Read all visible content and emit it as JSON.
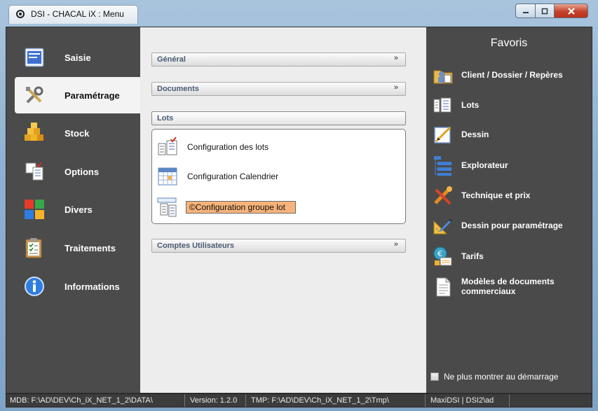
{
  "window": {
    "title": "DSI - CHACAL iX : Menu"
  },
  "nav": {
    "items": [
      {
        "label": "Saisie",
        "icon": "form-icon"
      },
      {
        "label": "Paramétrage",
        "icon": "tools-icon",
        "active": true
      },
      {
        "label": "Stock",
        "icon": "stock-boxes-icon"
      },
      {
        "label": "Options",
        "icon": "options-checklist-icon"
      },
      {
        "label": "Divers",
        "icon": "colored-squares-icon"
      },
      {
        "label": "Traitements",
        "icon": "clipboard-icon"
      },
      {
        "label": "Informations",
        "icon": "info-icon"
      }
    ]
  },
  "middle": {
    "sections": [
      {
        "label": "Général",
        "chevron": "»"
      },
      {
        "label": "Documents",
        "chevron": "»"
      },
      {
        "label": "Lots"
      },
      {
        "label": "Comptes Utilisateurs",
        "chevron": "»"
      }
    ],
    "lots_items": [
      {
        "label": "Configuration des lots",
        "icon": "lots-config-icon"
      },
      {
        "label": "Configuration Calendrier",
        "icon": "calendar-icon"
      },
      {
        "label": "©Configuration groupe lot",
        "icon": "group-lot-icon",
        "selected": true
      }
    ]
  },
  "favoris": {
    "title": "Favoris",
    "items": [
      {
        "label": "Client / Dossier / Repères",
        "icon": "client-folder-icon"
      },
      {
        "label": "Lots",
        "icon": "lots-icon"
      },
      {
        "label": "Dessin",
        "icon": "drawing-icon"
      },
      {
        "label": "Explorateur",
        "icon": "explorer-icon"
      },
      {
        "label": "Technique et prix",
        "icon": "tools-price-icon"
      },
      {
        "label": "Dessin pour paramétrage",
        "icon": "ruler-icon"
      },
      {
        "label": "Tarifs",
        "icon": "tariffs-icon"
      },
      {
        "label": "Modèles de documents commerciaux",
        "icon": "document-icon"
      }
    ],
    "startup_checkbox": {
      "label": "Ne plus montrer au démarrage",
      "checked": false
    }
  },
  "statusbar": {
    "mdb": "MDB: F:\\AD\\DEV\\Ch_iX_NET_1_2\\DATA\\",
    "version": "Version: 1.2.0",
    "tmp": "TMP: F:\\AD\\DEV\\Ch_iX_NET_1_2\\Tmp\\",
    "user": "MaxiDSI | DSI2\\ad"
  },
  "colors": {
    "highlight": "#f7b37a",
    "panel_dark": "#4a4a4a",
    "panel_light": "#ededed",
    "section_text": "#4a5a74"
  }
}
